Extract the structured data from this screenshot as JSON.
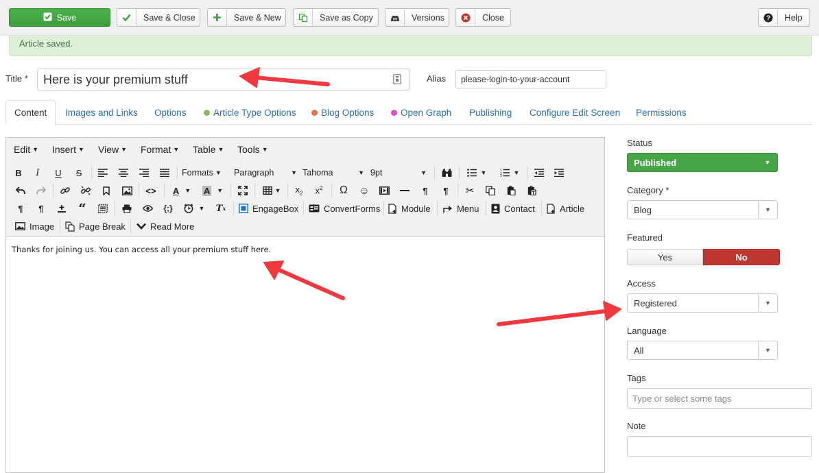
{
  "toolbar": {
    "save": "Save",
    "save_close": "Save & Close",
    "save_new": "Save & New",
    "save_copy": "Save as Copy",
    "versions": "Versions",
    "close": "Close",
    "help": "Help"
  },
  "alert": {
    "message": "Article saved."
  },
  "title": {
    "label": "Title",
    "required": "*",
    "value": "Here is your premium stuff"
  },
  "alias": {
    "label": "Alias",
    "value": "please-login-to-your-account"
  },
  "tabs": [
    {
      "label": "Content"
    },
    {
      "label": "Images and Links"
    },
    {
      "label": "Options"
    },
    {
      "label": "Article Type Options",
      "dot_color": "#8fb85a"
    },
    {
      "label": "Blog Options",
      "dot_color": "#e8704a"
    },
    {
      "label": "Open Graph",
      "dot_color": "#d94fc7"
    },
    {
      "label": "Publishing"
    },
    {
      "label": "Configure Edit Screen"
    },
    {
      "label": "Permissions"
    }
  ],
  "editor": {
    "menu": [
      "Edit",
      "Insert",
      "View",
      "Format",
      "Table",
      "Tools"
    ],
    "formats": "Formats",
    "block": "Paragraph",
    "font": "Tahoma",
    "size": "9pt",
    "buttons": {
      "engagebox": "EngageBox",
      "convertforms": "ConvertForms",
      "module": "Module",
      "menu": "Menu",
      "contact": "Contact",
      "article": "Article",
      "image": "Image",
      "page_break": "Page Break",
      "read_more": "Read More"
    },
    "content": "Thanks for joining us. You can access all your premium stuff here."
  },
  "sidebar": {
    "status": {
      "label": "Status",
      "value": "Published"
    },
    "category": {
      "label": "Category",
      "required": "*",
      "value": "Blog"
    },
    "featured": {
      "label": "Featured",
      "yes": "Yes",
      "no": "No",
      "selected": "No"
    },
    "access": {
      "label": "Access",
      "value": "Registered"
    },
    "language": {
      "label": "Language",
      "value": "All"
    },
    "tags": {
      "label": "Tags",
      "placeholder": "Type or select some tags"
    },
    "note": {
      "label": "Note",
      "value": ""
    }
  },
  "colors": {
    "save_green": "#46a546",
    "alert_bg": "#dff0d8",
    "link_blue": "#2a6fb5",
    "no_red": "#bd362f",
    "arrow_red": "#f0383f"
  }
}
